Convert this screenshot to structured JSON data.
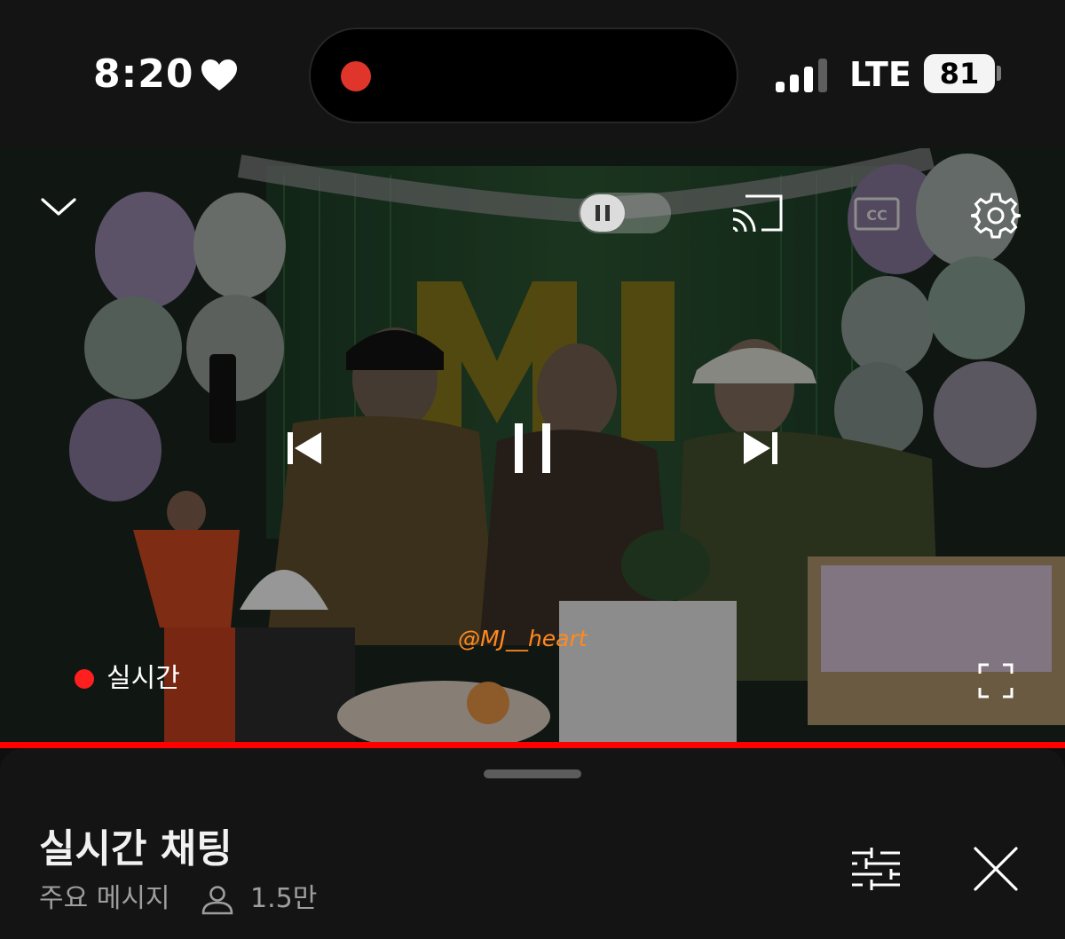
{
  "status_bar": {
    "time": "8:20",
    "network_type": "LTE",
    "battery_level": "81",
    "icons": [
      "heart-icon",
      "recording-dot",
      "signal-icon",
      "battery-icon"
    ],
    "colors": {
      "recording": "#e0352b"
    }
  },
  "player": {
    "live_label": "실시간",
    "watermark": "@MJ__heart",
    "progress": 1.0,
    "icons": [
      "chevron-down-icon",
      "autoplay-toggle",
      "cast-icon",
      "captions-icon",
      "settings-icon",
      "previous-icon",
      "pause-icon",
      "next-icon",
      "fullscreen-icon"
    ],
    "colors": {
      "live": "#ff1f1f",
      "progress": "#ff0000",
      "watermark": "#ff8a1f"
    }
  },
  "chat": {
    "title": "실시간 채팅",
    "filter_label": "주요 메시지",
    "viewer_count": "1.5만",
    "icons": [
      "person-icon",
      "sliders-icon",
      "close-icon"
    ]
  }
}
